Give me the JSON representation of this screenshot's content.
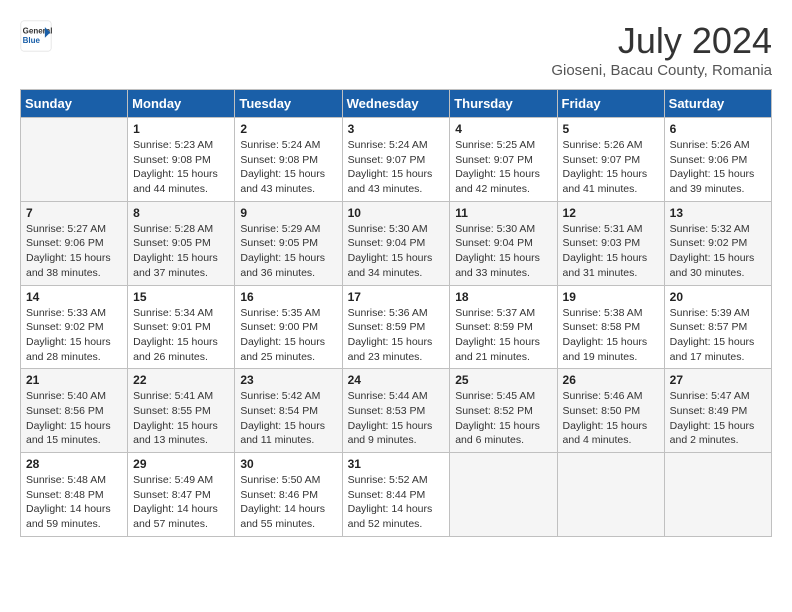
{
  "header": {
    "logo_general": "General",
    "logo_blue": "Blue",
    "title": "July 2024",
    "location": "Gioseni, Bacau County, Romania"
  },
  "days_of_week": [
    "Sunday",
    "Monday",
    "Tuesday",
    "Wednesday",
    "Thursday",
    "Friday",
    "Saturday"
  ],
  "weeks": [
    [
      {
        "day": "",
        "info": ""
      },
      {
        "day": "1",
        "info": "Sunrise: 5:23 AM\nSunset: 9:08 PM\nDaylight: 15 hours\nand 44 minutes."
      },
      {
        "day": "2",
        "info": "Sunrise: 5:24 AM\nSunset: 9:08 PM\nDaylight: 15 hours\nand 43 minutes."
      },
      {
        "day": "3",
        "info": "Sunrise: 5:24 AM\nSunset: 9:07 PM\nDaylight: 15 hours\nand 43 minutes."
      },
      {
        "day": "4",
        "info": "Sunrise: 5:25 AM\nSunset: 9:07 PM\nDaylight: 15 hours\nand 42 minutes."
      },
      {
        "day": "5",
        "info": "Sunrise: 5:26 AM\nSunset: 9:07 PM\nDaylight: 15 hours\nand 41 minutes."
      },
      {
        "day": "6",
        "info": "Sunrise: 5:26 AM\nSunset: 9:06 PM\nDaylight: 15 hours\nand 39 minutes."
      }
    ],
    [
      {
        "day": "7",
        "info": "Sunrise: 5:27 AM\nSunset: 9:06 PM\nDaylight: 15 hours\nand 38 minutes."
      },
      {
        "day": "8",
        "info": "Sunrise: 5:28 AM\nSunset: 9:05 PM\nDaylight: 15 hours\nand 37 minutes."
      },
      {
        "day": "9",
        "info": "Sunrise: 5:29 AM\nSunset: 9:05 PM\nDaylight: 15 hours\nand 36 minutes."
      },
      {
        "day": "10",
        "info": "Sunrise: 5:30 AM\nSunset: 9:04 PM\nDaylight: 15 hours\nand 34 minutes."
      },
      {
        "day": "11",
        "info": "Sunrise: 5:30 AM\nSunset: 9:04 PM\nDaylight: 15 hours\nand 33 minutes."
      },
      {
        "day": "12",
        "info": "Sunrise: 5:31 AM\nSunset: 9:03 PM\nDaylight: 15 hours\nand 31 minutes."
      },
      {
        "day": "13",
        "info": "Sunrise: 5:32 AM\nSunset: 9:02 PM\nDaylight: 15 hours\nand 30 minutes."
      }
    ],
    [
      {
        "day": "14",
        "info": "Sunrise: 5:33 AM\nSunset: 9:02 PM\nDaylight: 15 hours\nand 28 minutes."
      },
      {
        "day": "15",
        "info": "Sunrise: 5:34 AM\nSunset: 9:01 PM\nDaylight: 15 hours\nand 26 minutes."
      },
      {
        "day": "16",
        "info": "Sunrise: 5:35 AM\nSunset: 9:00 PM\nDaylight: 15 hours\nand 25 minutes."
      },
      {
        "day": "17",
        "info": "Sunrise: 5:36 AM\nSunset: 8:59 PM\nDaylight: 15 hours\nand 23 minutes."
      },
      {
        "day": "18",
        "info": "Sunrise: 5:37 AM\nSunset: 8:59 PM\nDaylight: 15 hours\nand 21 minutes."
      },
      {
        "day": "19",
        "info": "Sunrise: 5:38 AM\nSunset: 8:58 PM\nDaylight: 15 hours\nand 19 minutes."
      },
      {
        "day": "20",
        "info": "Sunrise: 5:39 AM\nSunset: 8:57 PM\nDaylight: 15 hours\nand 17 minutes."
      }
    ],
    [
      {
        "day": "21",
        "info": "Sunrise: 5:40 AM\nSunset: 8:56 PM\nDaylight: 15 hours\nand 15 minutes."
      },
      {
        "day": "22",
        "info": "Sunrise: 5:41 AM\nSunset: 8:55 PM\nDaylight: 15 hours\nand 13 minutes."
      },
      {
        "day": "23",
        "info": "Sunrise: 5:42 AM\nSunset: 8:54 PM\nDaylight: 15 hours\nand 11 minutes."
      },
      {
        "day": "24",
        "info": "Sunrise: 5:44 AM\nSunset: 8:53 PM\nDaylight: 15 hours\nand 9 minutes."
      },
      {
        "day": "25",
        "info": "Sunrise: 5:45 AM\nSunset: 8:52 PM\nDaylight: 15 hours\nand 6 minutes."
      },
      {
        "day": "26",
        "info": "Sunrise: 5:46 AM\nSunset: 8:50 PM\nDaylight: 15 hours\nand 4 minutes."
      },
      {
        "day": "27",
        "info": "Sunrise: 5:47 AM\nSunset: 8:49 PM\nDaylight: 15 hours\nand 2 minutes."
      }
    ],
    [
      {
        "day": "28",
        "info": "Sunrise: 5:48 AM\nSunset: 8:48 PM\nDaylight: 14 hours\nand 59 minutes."
      },
      {
        "day": "29",
        "info": "Sunrise: 5:49 AM\nSunset: 8:47 PM\nDaylight: 14 hours\nand 57 minutes."
      },
      {
        "day": "30",
        "info": "Sunrise: 5:50 AM\nSunset: 8:46 PM\nDaylight: 14 hours\nand 55 minutes."
      },
      {
        "day": "31",
        "info": "Sunrise: 5:52 AM\nSunset: 8:44 PM\nDaylight: 14 hours\nand 52 minutes."
      },
      {
        "day": "",
        "info": ""
      },
      {
        "day": "",
        "info": ""
      },
      {
        "day": "",
        "info": ""
      }
    ]
  ]
}
